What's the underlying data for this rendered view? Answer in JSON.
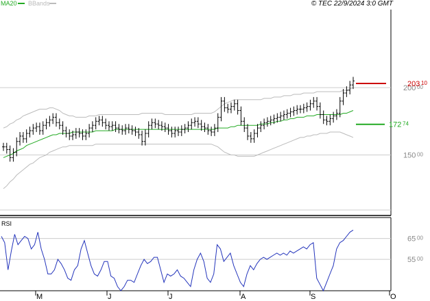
{
  "header": {
    "legend_ma": "MA20",
    "legend_bb": "BBands",
    "copyright": "© TEC 22/9/2024 3:0 GMT"
  },
  "colors": {
    "price": "#000000",
    "ma": "#22aa22",
    "bbands": "#bbbbbb",
    "last_price_marker": "#cc0000",
    "ma_marker": "#22aa22",
    "rsi_line": "#2233bb",
    "grid": "#cccccc",
    "axis_text": "#888888"
  },
  "markers": {
    "last_price": {
      "value": 203.1,
      "big": "203",
      "small": "10"
    },
    "ma_value": {
      "value": 172.74,
      "big": "172",
      "small": "74"
    }
  },
  "chart_data": [
    {
      "type": "ohlc",
      "title": "",
      "y_ticks": [
        {
          "value": 200,
          "big": "200",
          "small": "00"
        },
        {
          "value": 150,
          "big": "150",
          "small": "00"
        }
      ],
      "ylim": [
        105,
        258
      ],
      "x_ticks": [
        "M",
        "J",
        "J",
        "A",
        "S",
        "O"
      ],
      "grid": "horizontal",
      "legend": [
        "MA20",
        "BBands"
      ],
      "close": [
        156,
        154,
        148,
        152,
        160,
        164,
        162,
        166,
        168,
        170,
        171,
        168,
        172,
        174,
        176,
        178,
        174,
        172,
        168,
        166,
        164,
        165,
        167,
        166,
        164,
        166,
        170,
        172,
        175,
        176,
        174,
        172,
        171,
        172,
        170,
        169,
        168,
        170,
        169,
        168,
        167,
        165,
        160,
        166,
        172,
        174,
        173,
        172,
        171,
        170,
        168,
        166,
        168,
        167,
        169,
        170,
        172,
        174,
        175,
        173,
        171,
        170,
        168,
        167,
        170,
        178,
        190,
        185,
        184,
        186,
        188,
        183,
        175,
        170,
        164,
        162,
        166,
        170,
        172,
        174,
        175,
        176,
        177,
        178,
        179,
        180,
        181,
        182,
        183,
        184,
        184,
        185,
        186,
        188,
        190,
        186,
        180,
        176,
        175,
        177,
        179,
        181,
        190,
        196,
        198,
        202,
        205
      ],
      "ma20": [
        148,
        149,
        150,
        151,
        153,
        154,
        155,
        157,
        158,
        159,
        160,
        161,
        162,
        163,
        164,
        165,
        165,
        166,
        166,
        166,
        166,
        167,
        167,
        167,
        167,
        167,
        167,
        167,
        168,
        168,
        168,
        168,
        168,
        168,
        169,
        169,
        169,
        169,
        169,
        169,
        169,
        169,
        169,
        169,
        169,
        169,
        169,
        169,
        169,
        169,
        169,
        169,
        169,
        169,
        169,
        169,
        169,
        169,
        169,
        169,
        169,
        169,
        169,
        169,
        169,
        170,
        170,
        170,
        170,
        171,
        171,
        172,
        172,
        172,
        172,
        172,
        172,
        172,
        173,
        173,
        173,
        174,
        174,
        175,
        175,
        176,
        176,
        177,
        177,
        178,
        178,
        178,
        179,
        179,
        179,
        180,
        180,
        180,
        180,
        180,
        180,
        180,
        180,
        181,
        181,
        182,
        183
      ],
      "bb_upper": [
        170,
        171,
        173,
        174,
        176,
        177,
        179,
        180,
        181,
        182,
        183,
        184,
        184,
        184,
        185,
        185,
        184,
        183,
        181,
        180,
        179,
        179,
        178,
        178,
        178,
        178,
        179,
        179,
        179,
        180,
        180,
        180,
        180,
        180,
        180,
        180,
        180,
        180,
        180,
        180,
        180,
        180,
        181,
        181,
        181,
        181,
        181,
        181,
        181,
        180,
        180,
        180,
        180,
        180,
        180,
        180,
        180,
        180,
        181,
        181,
        181,
        181,
        181,
        181,
        182,
        184,
        186,
        188,
        189,
        190,
        191,
        191,
        191,
        191,
        191,
        191,
        191,
        191,
        191,
        192,
        192,
        192,
        193,
        193,
        193,
        194,
        194,
        194,
        195,
        195,
        195,
        196,
        196,
        196,
        196,
        197,
        197,
        197,
        197,
        197,
        197,
        197,
        197,
        198,
        198,
        199,
        200
      ],
      "bb_lower": [
        125,
        127,
        130,
        132,
        135,
        137,
        139,
        141,
        143,
        144,
        146,
        148,
        149,
        150,
        152,
        153,
        154,
        155,
        156,
        156,
        157,
        157,
        157,
        157,
        157,
        157,
        157,
        157,
        158,
        158,
        158,
        158,
        158,
        158,
        158,
        158,
        158,
        158,
        158,
        158,
        158,
        158,
        158,
        158,
        158,
        158,
        158,
        158,
        158,
        158,
        158,
        158,
        158,
        158,
        158,
        158,
        158,
        158,
        158,
        158,
        158,
        158,
        158,
        158,
        157,
        156,
        154,
        152,
        151,
        150,
        150,
        149,
        149,
        149,
        149,
        149,
        149,
        150,
        151,
        152,
        153,
        154,
        155,
        156,
        157,
        158,
        159,
        160,
        161,
        162,
        163,
        163,
        164,
        164,
        165,
        165,
        166,
        166,
        166,
        167,
        167,
        167,
        167,
        166,
        165,
        164,
        163
      ]
    },
    {
      "type": "line",
      "title": "RSI",
      "y_ticks": [
        {
          "value": 65,
          "big": "65",
          "small": "00"
        },
        {
          "value": 55,
          "big": "55",
          "small": "00"
        }
      ],
      "ylim": [
        40,
        75
      ],
      "values": [
        66,
        63,
        50,
        59,
        67,
        62,
        64,
        66,
        65,
        60,
        62,
        68,
        60,
        55,
        48,
        48,
        50,
        55,
        53,
        50,
        46,
        45,
        50,
        52,
        60,
        64,
        58,
        52,
        48,
        47,
        50,
        54,
        54,
        47,
        46,
        42,
        40,
        42,
        45,
        45,
        44,
        48,
        52,
        55,
        53,
        54,
        56,
        56,
        50,
        44,
        48,
        47,
        48,
        50,
        47,
        46,
        44,
        42,
        50,
        55,
        58,
        54,
        46,
        44,
        48,
        62,
        60,
        54,
        56,
        58,
        52,
        48,
        44,
        42,
        48,
        52,
        50,
        53,
        55,
        56,
        55,
        56,
        57,
        58,
        57,
        58,
        57,
        59,
        58,
        59,
        60,
        61,
        60,
        62,
        63,
        46,
        43,
        40,
        44,
        48,
        52,
        60,
        63,
        64,
        66,
        68,
        69
      ],
      "grid": "horizontal"
    }
  ]
}
